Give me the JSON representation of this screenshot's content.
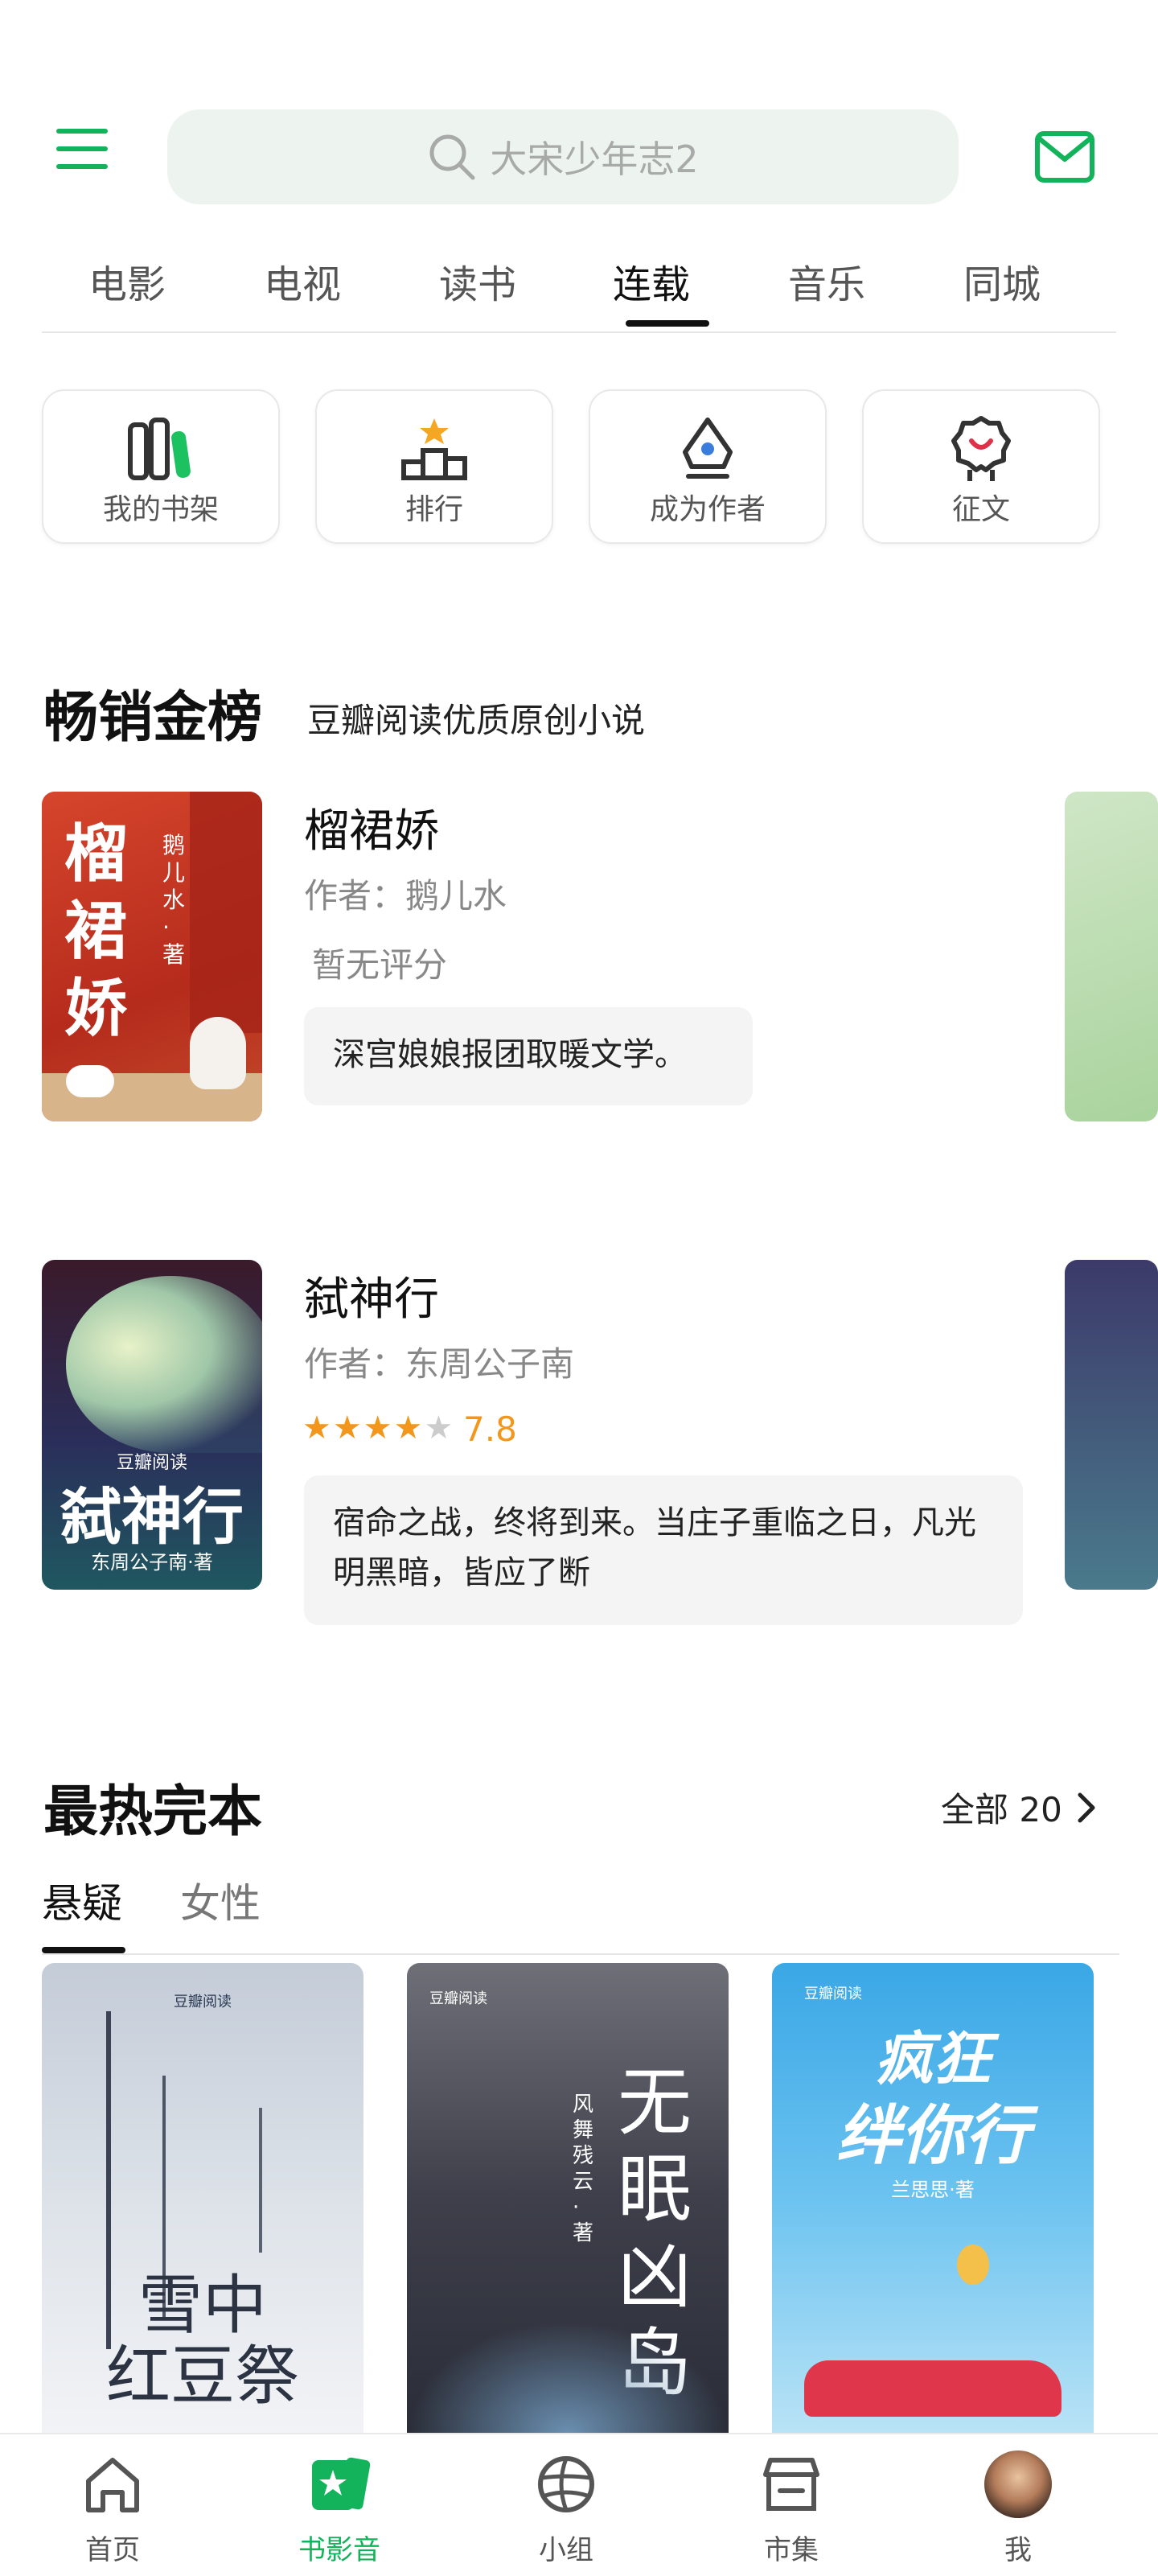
{
  "header": {
    "search_placeholder": "大宋少年志2"
  },
  "tabs": [
    {
      "label": "电影"
    },
    {
      "label": "电视"
    },
    {
      "label": "读书"
    },
    {
      "label": "连载"
    },
    {
      "label": "音乐"
    },
    {
      "label": "同城"
    }
  ],
  "active_tab": "连载",
  "quick": [
    {
      "label": "我的书架",
      "icon": "bookshelf-icon"
    },
    {
      "label": "排行",
      "icon": "ranking-podium-icon"
    },
    {
      "label": "成为作者",
      "icon": "pen-nib-icon"
    },
    {
      "label": "征文",
      "icon": "award-badge-icon"
    }
  ],
  "bestsellers": {
    "title": "畅销金榜",
    "subtitle": "豆瓣阅读优质原创小说",
    "books": [
      {
        "title": "榴裙娇",
        "author": "作者：鹅儿水",
        "rating_text": "暂无评分",
        "description": "深宫娘娘报团取暖文学。",
        "cover_text": "榴裙娇",
        "cover_author": "鹅儿水·著"
      },
      {
        "title": "弑神行",
        "author": "作者：东周公子南",
        "stars": 4,
        "score": "7.8",
        "description": "宿命之战，终将到来。当庄子重临之日，凡光明黑暗，皆应了断",
        "cover_text": "弑神行",
        "cover_author": "东周公子南·著",
        "cover_brand": "豆瓣阅读"
      }
    ]
  },
  "hot_complete": {
    "title": "最热完本",
    "all_label": "全部 20",
    "subtabs": [
      {
        "label": "悬疑"
      },
      {
        "label": "女性"
      }
    ],
    "books": [
      {
        "cover_text_1": "雪中",
        "cover_text_2": "红豆祭",
        "brand": "豆瓣阅读"
      },
      {
        "cover_text": "无眠凶岛",
        "author": "风舞残云·著",
        "brand": "豆瓣阅读"
      },
      {
        "cover_text_1": "疯狂",
        "cover_text_2": "绊你行",
        "author": "兰思思·著",
        "brand": "豆瓣阅读"
      }
    ]
  },
  "bottom_nav": [
    {
      "label": "首页",
      "icon": "home-icon"
    },
    {
      "label": "书影音",
      "icon": "star-tickets-icon"
    },
    {
      "label": "小组",
      "icon": "group-ball-icon"
    },
    {
      "label": "市集",
      "icon": "market-stall-icon"
    },
    {
      "label": "我",
      "icon": "avatar"
    }
  ],
  "colors": {
    "brand_green": "#12b35a",
    "rating_orange": "#f2971c"
  }
}
